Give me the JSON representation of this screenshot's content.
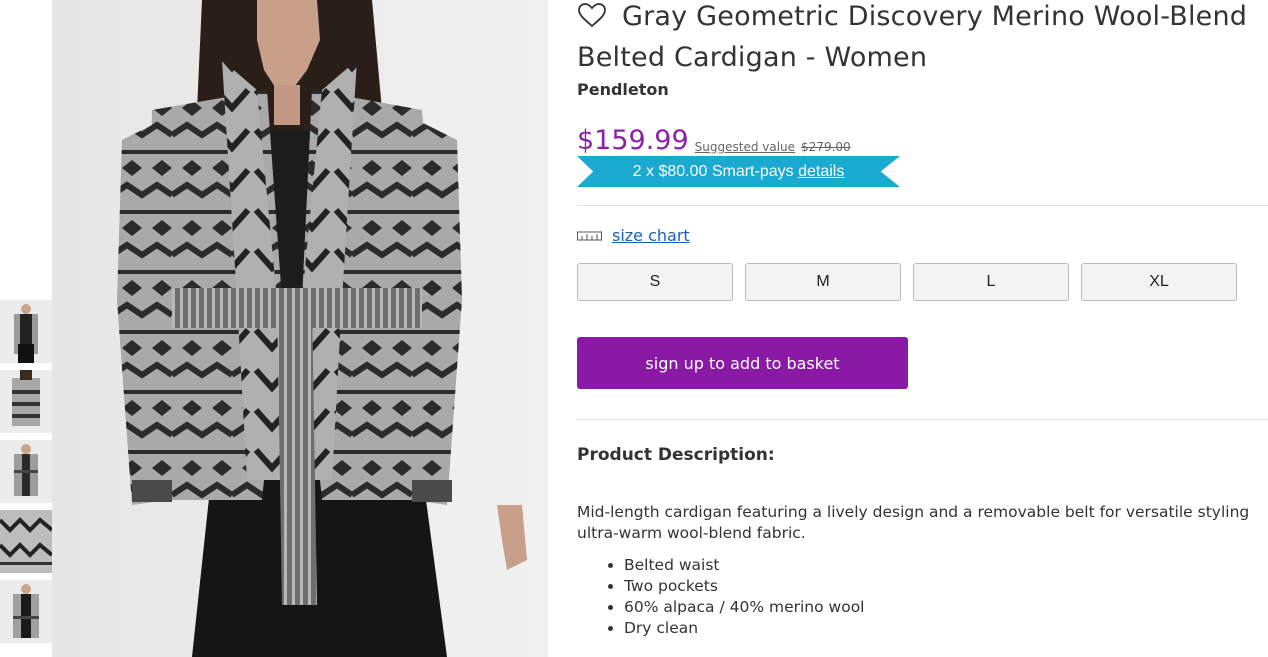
{
  "product": {
    "title": "Gray Geometric Discovery Merino Wool-Blend Belted Cardigan - Women",
    "brand": "Pendleton"
  },
  "pricing": {
    "price": "$159.99",
    "suggested_label": "Suggested value",
    "suggested_price": "$279.00",
    "smartpays_text": "2 x $80.00 Smart-pays",
    "smartpays_link": "details",
    "price_color": "#8a22a8",
    "ribbon_color": "#1aa9d0"
  },
  "size_chart_label": "size chart",
  "sizes": [
    "S",
    "M",
    "L",
    "XL"
  ],
  "basket_button": "sign up to add to basket",
  "description": {
    "heading": "Product Description:",
    "text": "Mid-length cardigan featuring a lively design and a removable belt for versatile styling ultra-warm wool-blend fabric.",
    "bullets": [
      "Belted waist",
      "Two pockets",
      "60% alpaca / 40% merino wool",
      "Dry clean"
    ]
  },
  "icons": {
    "favorite": "heart-outline-icon",
    "size_chart": "ruler-icon"
  },
  "accent_color": "#8a1aa6"
}
